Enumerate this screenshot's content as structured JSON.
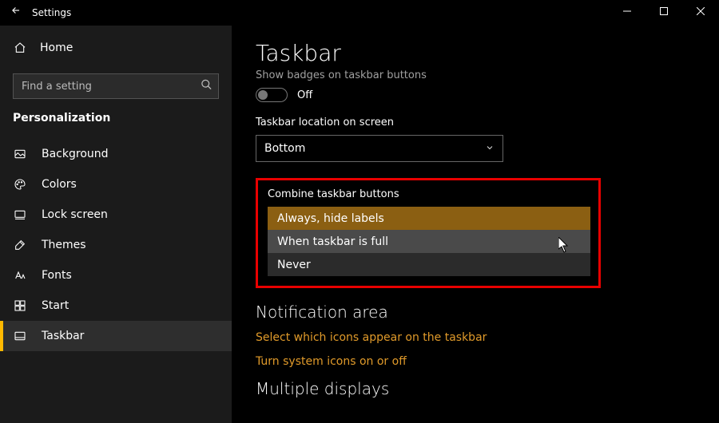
{
  "titlebar": {
    "title": "Settings"
  },
  "home": {
    "label": "Home"
  },
  "search": {
    "placeholder": "Find a setting"
  },
  "category": {
    "label": "Personalization"
  },
  "nav": {
    "items": [
      {
        "label": "Background"
      },
      {
        "label": "Colors"
      },
      {
        "label": "Lock screen"
      },
      {
        "label": "Themes"
      },
      {
        "label": "Fonts"
      },
      {
        "label": "Start"
      },
      {
        "label": "Taskbar"
      }
    ]
  },
  "page": {
    "title": "Taskbar",
    "badges_label": "Show badges on taskbar buttons",
    "toggle_state": "Off",
    "location_label": "Taskbar location on screen",
    "location_value": "Bottom",
    "combine_label": "Combine taskbar buttons",
    "combine_options": [
      "Always, hide labels",
      "When taskbar is full",
      "Never"
    ],
    "notif_section": "Notification area",
    "link1": "Select which icons appear on the taskbar",
    "link2": "Turn system icons on or off",
    "multi_section": "Multiple displays"
  }
}
